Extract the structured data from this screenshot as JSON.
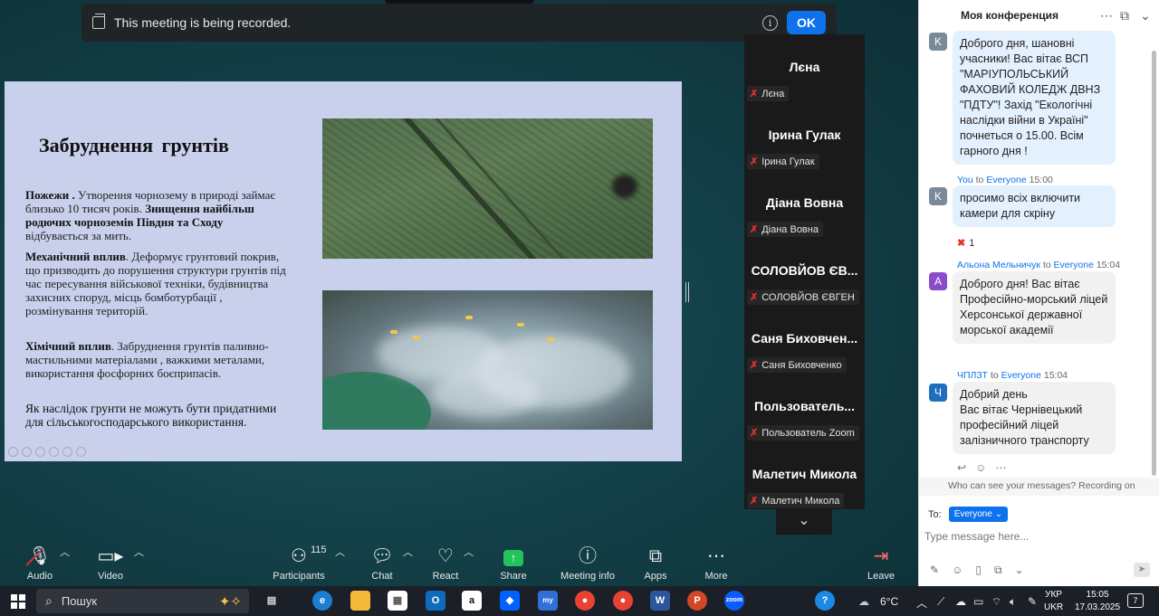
{
  "banner": {
    "text": "This meeting is being recorded.",
    "ok_label": "OK"
  },
  "slide": {
    "title": "Забруднення  грунтів",
    "p1_bold": "Пожежи .",
    "p1_text": " Утворення чорнозему в природі займає близько 10 тисяч років. ",
    "p1_bold2": "Знищення найбільш родючих чорноземів  Півдня та Сходу",
    "p1_tail": " відбувається за мить.",
    "p2_bold": "Механічний  вплив",
    "p2_text": ". Деформує грунтовий покрив, що призводить до порушення структури грунтів  під час пересування військової техніки, будівництва захисних споруд, місць бомботурбації , розмінування територій.",
    "p3_bold": "Хімічний вплив",
    "p3_text": ". Забруднення грунтів паливно-мастильними матеріалами , важкими металами, використання фосфорних боєприпасів.",
    "p4_text": "Як наслідок грунти   не можуть бути придатними для сільськогосподарського використання."
  },
  "participants": [
    {
      "tile": "Лєна",
      "tag": "Лєна"
    },
    {
      "tile": "Ірина Гулак",
      "tag": "Ірина Гулак"
    },
    {
      "tile": "Діана Вовна",
      "tag": "Діана Вовна"
    },
    {
      "tile": "СОЛОВЙОВ ЄВ...",
      "tag": "СОЛОВЙОВ ЄВГЕН"
    },
    {
      "tile": "Саня Биховчен...",
      "tag": "Саня Биховченко"
    },
    {
      "tile": "Пользователь...",
      "tag": "Пользователь Zoom"
    },
    {
      "tile": "Малетич Микола",
      "tag": "Малетич Микола"
    }
  ],
  "toolbar": {
    "audio": "Audio",
    "video": "Video",
    "participants": "Participants",
    "participants_count": "115",
    "chat": "Chat",
    "react": "React",
    "share": "Share",
    "meeting_info": "Meeting info",
    "apps": "Apps",
    "more": "More",
    "leave": "Leave"
  },
  "chat": {
    "title": "Моя конференция",
    "messages": [
      {
        "avatar": "K",
        "text": "Доброго дня, шановні учасники! Вас вітає ВСП \"МАРІУПОЛЬСЬКИЙ ФАХОВИЙ КОЛЕДЖ ДВНЗ \"ПДТУ\"! Захід \"Екологічні наслідки війни в Україні\" почнеться о 15.00. Всім гарного дня !"
      },
      {
        "from": "You",
        "to_word": "to",
        "to": "Everyone",
        "time": "15:00",
        "avatar": "K",
        "text": "просимо всіх включити камери для  скріну"
      },
      {
        "from": "Альона Мельничук",
        "to_word": "to",
        "to": "Everyone",
        "time": "15:04",
        "avatar": "А",
        "text": "Доброго дня! Вас вітає Професійно-морський ліцей Херсонської державної морської академії"
      },
      {
        "from": "ЧПЛЗТ",
        "to_word": "to",
        "to": "Everyone",
        "time": "15:04",
        "avatar": "Ч",
        "text": "Добрий день\nВас вітає Чернівецький професійний ліцей залізничного транспорту"
      }
    ],
    "reaction_count": "1",
    "privacy": "Who can see your messages? Recording on",
    "to_label": "To:",
    "to_value": "Everyone",
    "input_placeholder": "Type message here...",
    "avatar_colors": {
      "k": "#7a8a99",
      "a": "#8a4cc9",
      "ch": "#1e6fbf"
    }
  },
  "taskbar": {
    "search_label": "Пошук",
    "weather": "6°C",
    "lang_top": "УКР",
    "lang_bottom": "UKR",
    "time": "15:05",
    "date": "17.03.2025",
    "notifications": "7"
  }
}
